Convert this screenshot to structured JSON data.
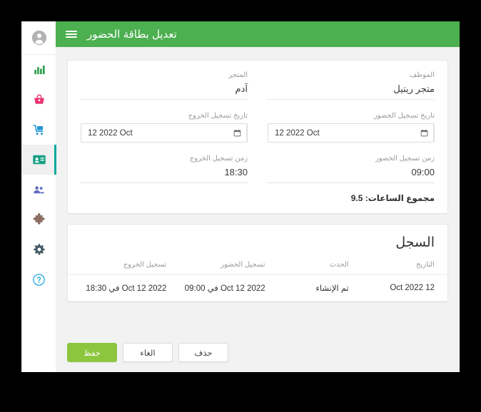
{
  "topbar": {
    "title": "تعديل بطاقة الحضور",
    "menu_icon": "hamburger-icon",
    "color": "#4CAF50"
  },
  "rail": {
    "avatar_icon": "user-avatar-icon",
    "items": [
      {
        "icon": "bar-chart-icon",
        "color": "#2E9E4F",
        "active": false
      },
      {
        "icon": "shopping-basket-icon",
        "color": "#E8336D",
        "active": false
      },
      {
        "icon": "delivery-cart-icon",
        "color": "#2196D3",
        "active": false
      },
      {
        "icon": "id-card-icon",
        "color": "#16A085",
        "active": true
      },
      {
        "icon": "users-icon",
        "color": "#5C6BC0",
        "active": false
      },
      {
        "icon": "puzzle-piece-icon",
        "color": "#8D6E63",
        "active": false
      },
      {
        "icon": "gear-icon",
        "color": "#455A64",
        "active": false
      },
      {
        "icon": "help-circle-icon",
        "color": "#29ABE2",
        "active": false
      }
    ],
    "active_indicator_color": "#00A99D"
  },
  "form": {
    "employee": {
      "label": "الموظف",
      "value": "متجر ريتيل"
    },
    "store": {
      "label": "المتجر",
      "value": "آدم"
    },
    "checkin_date": {
      "label": "تاريخ تسجيل الحضور",
      "value": "12 2022 Oct",
      "icon": "calendar-icon"
    },
    "checkout_date": {
      "label": "تاريخ تسجيل الخروج",
      "value": "12 2022 Oct",
      "icon": "calendar-icon"
    },
    "checkin_time": {
      "label": "زمن تسجيل الحضور",
      "value": "09:00"
    },
    "checkout_time": {
      "label": "زمن تسجيل الخروج",
      "value": "18:30"
    },
    "total_hours": "مجموع الساعات: 9.5"
  },
  "log": {
    "title": "السجل",
    "columns": [
      "التاريخ",
      "الحدث",
      "تسجيل الحضور",
      "تسجيل الخروج"
    ],
    "rows": [
      {
        "date": "12 Oct 2022",
        "event": "تم الإنشاء",
        "checkin": "2022 Oct 12 في 09:00",
        "checkout": "2022 Oct 12 في 18:30"
      }
    ]
  },
  "footer": {
    "save_label": "حفظ",
    "cancel_label": "الغاء",
    "delete_label": "حذف",
    "save_color": "#8CC63F"
  }
}
